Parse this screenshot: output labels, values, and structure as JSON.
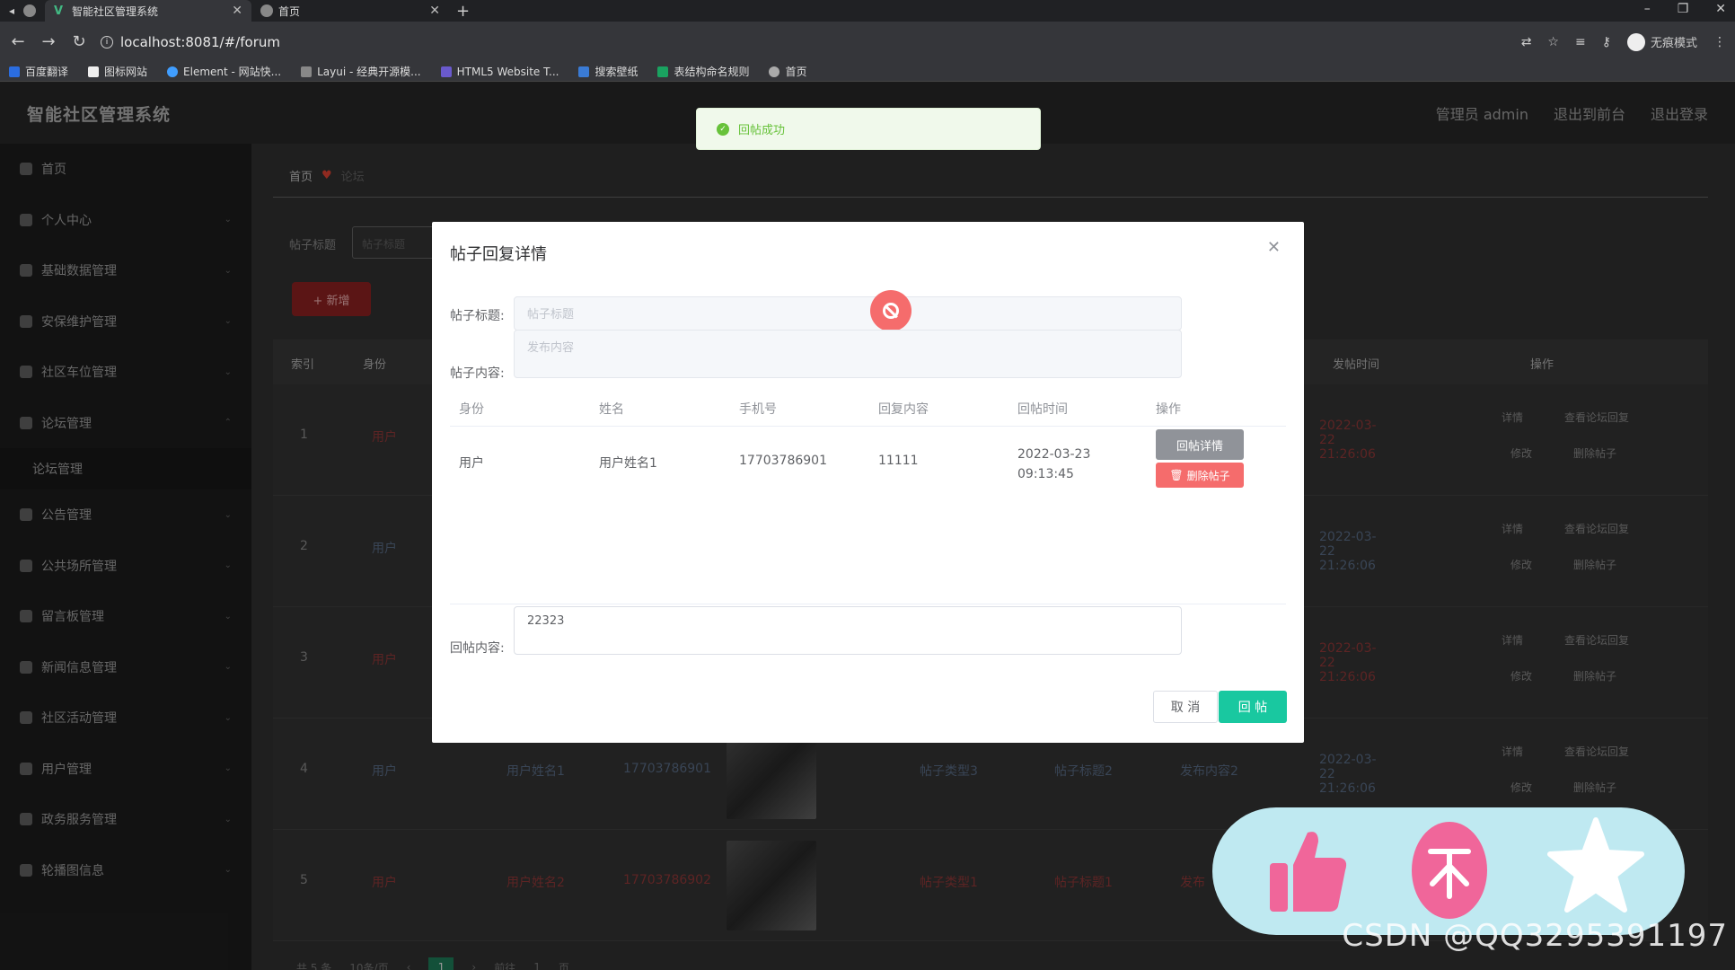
{
  "browser": {
    "tabs": [
      {
        "title": "智能社区管理系统",
        "active": true
      },
      {
        "title": "首页",
        "active": false
      }
    ],
    "url": "localhost:8081/#/forum",
    "incognito_label": "无痕模式",
    "bookmarks": [
      "百度翻译",
      "图标网站",
      "Element - 网站快...",
      "Layui - 经典开源模...",
      "HTML5 Website T...",
      "搜索壁纸",
      "表结构命名规则",
      "首页"
    ]
  },
  "app": {
    "title": "智能社区管理系统",
    "header_links": [
      "管理员 admin",
      "退出到前台",
      "退出登录"
    ]
  },
  "sidebar": {
    "items": [
      {
        "label": "首页"
      },
      {
        "label": "个人中心"
      },
      {
        "label": "基础数据管理"
      },
      {
        "label": "安保维护管理"
      },
      {
        "label": "社区车位管理"
      },
      {
        "label": "论坛管理"
      },
      {
        "label": "公告管理"
      },
      {
        "label": "公共场所管理"
      },
      {
        "label": "留言板管理"
      },
      {
        "label": "新闻信息管理"
      },
      {
        "label": "社区活动管理"
      },
      {
        "label": "用户管理"
      },
      {
        "label": "政务服务管理"
      },
      {
        "label": "轮播图信息"
      }
    ],
    "sub_item": "论坛管理"
  },
  "main": {
    "breadcrumb": [
      "首页",
      "论坛"
    ],
    "search_label": "帖子标题",
    "search_placeholder": "帖子标题",
    "add_button": "+ 新增",
    "columns": [
      "索引",
      "身份",
      "发帖时间",
      "操作"
    ],
    "rows": [
      {
        "index": "1",
        "role": "用户",
        "time": "2022-03-22 21:26:06"
      },
      {
        "index": "2",
        "role": "用户",
        "time": "2022-03-22 21:26:06"
      },
      {
        "index": "3",
        "role": "用户",
        "time": "2022-03-22 21:26:06"
      },
      {
        "index": "4",
        "role": "用户",
        "name": "用户姓名1",
        "phone": "17703786901",
        "type": "帖子类型3",
        "title": "帖子标题2",
        "content": "发布内容2",
        "time": "2022-03-22 21:26:06"
      },
      {
        "index": "5",
        "role": "用户",
        "name": "用户姓名2",
        "phone": "17703786902",
        "type": "帖子类型1",
        "title": "帖子标题1",
        "content": "发布"
      }
    ],
    "row_ops": [
      "详情",
      "查看论坛回复",
      "修改",
      "删除帖子"
    ],
    "pager": {
      "total": "共 5 条",
      "page_size": "10条/页",
      "current": "1",
      "goto": "前往",
      "goto_value": "1",
      "page_suffix": "页"
    }
  },
  "toast": {
    "message": "回帖成功"
  },
  "dialog": {
    "title": "帖子回复详情",
    "fields": {
      "post_title_label": "帖子标题:",
      "post_title_placeholder": "帖子标题",
      "post_content_label": "帖子内容:",
      "post_content_placeholder": "发布内容"
    },
    "table": {
      "columns": [
        "身份",
        "姓名",
        "手机号",
        "回复内容",
        "回帖时间",
        "操作"
      ],
      "row": {
        "role": "用户",
        "name": "用户姓名1",
        "phone": "17703786901",
        "reply": "11111",
        "time": "2022-03-23 09:13:45"
      },
      "detail_button": "回帖详情",
      "delete_button": "删除帖子"
    },
    "reply_label": "回帖内容:",
    "reply_value": "22323",
    "cancel_button": "取 消",
    "submit_button": "回 帖"
  },
  "watermark": "CSDN @QQ3295391197",
  "colors": {
    "accent": "#19c8a0",
    "danger": "#f56c6c",
    "success": "#67c23a",
    "widget_bg": "#bfe9f1",
    "coin": "#f0669a"
  }
}
